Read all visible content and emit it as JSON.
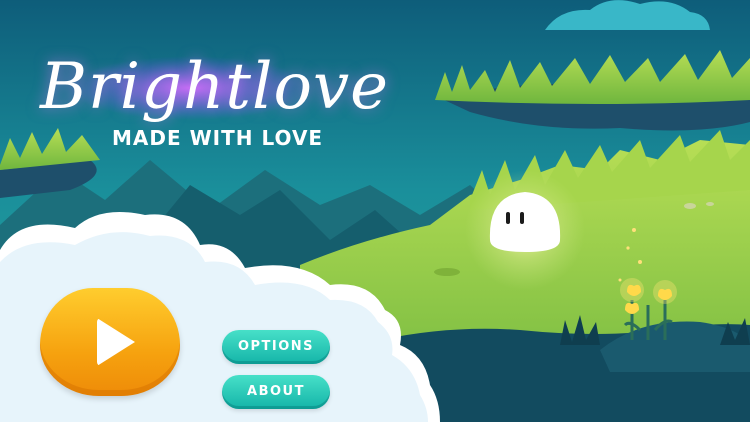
{
  "game": {
    "title": "Brightlove",
    "subtitle": "MADE WITH LOVE"
  },
  "menu": {
    "play_icon": "play-icon",
    "options_label": "OPTIONS",
    "about_label": "ABOUT"
  },
  "colors": {
    "play_button": "#f7a90f",
    "menu_button": "#2cc8b8",
    "sky": "#16899a",
    "grass": "#9fd14a",
    "blob": "#ffffff"
  }
}
